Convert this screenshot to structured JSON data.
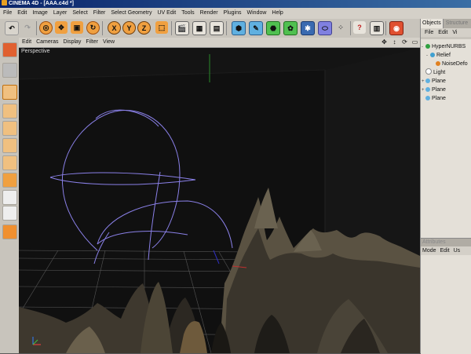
{
  "window": {
    "title": "CINEMA 4D - [AAA.c4d *]"
  },
  "menubar": [
    "File",
    "Edit",
    "Image",
    "Layer",
    "Select",
    "Filter",
    "Select Geometry",
    "UV Edit",
    "Tools",
    "Render",
    "Plugins",
    "Window",
    "Help"
  ],
  "toolbar": {
    "axis_buttons": [
      "X",
      "Y",
      "Z"
    ]
  },
  "viewport": {
    "menu": [
      "Edit",
      "Cameras",
      "Display",
      "Filter",
      "View"
    ],
    "label": "Perspective"
  },
  "objects_panel": {
    "tabs": [
      "Objects",
      "Structure"
    ],
    "menu": [
      "File",
      "Edit",
      "Vi"
    ],
    "items": [
      {
        "name": "HyperNURBS",
        "icon": "hypernurbs-icon"
      },
      {
        "name": "Relief",
        "icon": "relief-icon"
      },
      {
        "name": "NoiseDefo",
        "icon": "noise-deformer-icon"
      },
      {
        "name": "Light",
        "icon": "light-icon"
      },
      {
        "name": "Plane",
        "icon": "plane-icon"
      },
      {
        "name": "Plane",
        "icon": "plane-icon"
      },
      {
        "name": "Plane",
        "icon": "plane-icon"
      }
    ]
  },
  "attributes_panel": {
    "tab": "Attributes",
    "menu": [
      "Mode",
      "Edit",
      "Us"
    ]
  },
  "colors": {
    "title_bar": "#0a246a",
    "viewport_bg": "#141414",
    "spline": "#8a80e8",
    "selected_tool": "#f0c080"
  }
}
